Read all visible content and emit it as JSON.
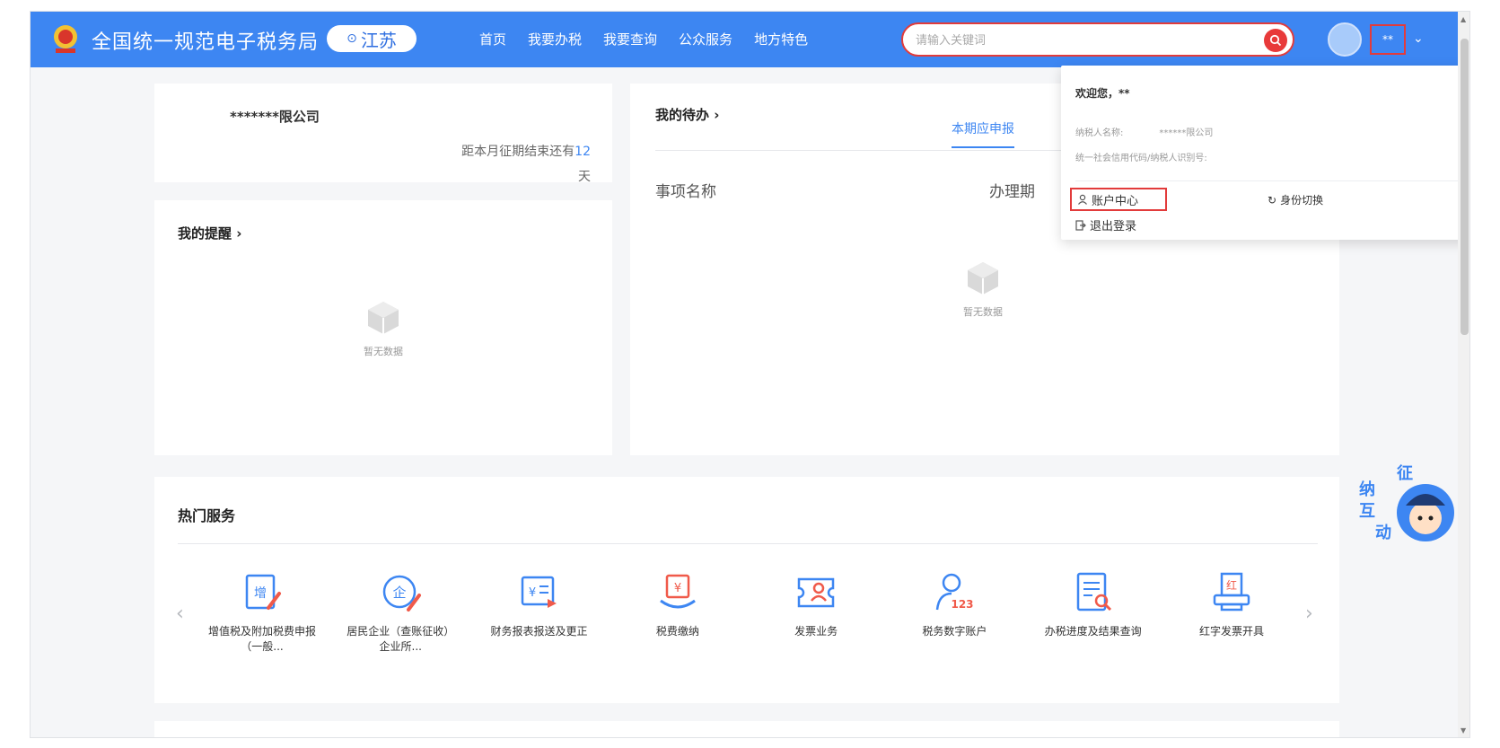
{
  "header": {
    "site_title": "全国统一规范电子税务局",
    "region": "江苏",
    "nav": [
      "首页",
      "我要办税",
      "我要查询",
      "公众服务",
      "地方特色"
    ],
    "search_placeholder": "请输入关键词",
    "user_short": "**"
  },
  "company": {
    "name": "*******限公司",
    "deadline_prefix": "距本月征期结束还有",
    "deadline_days": "12",
    "deadline_unit": "天"
  },
  "reminders": {
    "title": "我的提醒 ›",
    "empty_text": "暂无数据"
  },
  "todo": {
    "title": "我的待办 ›",
    "tab": "本期应申报",
    "col_name": "事项名称",
    "col_deadline": "办理期",
    "empty_text": "暂无数据"
  },
  "hot": {
    "title": "热门服务",
    "items": [
      {
        "label": "增值税及附加税费申报（一般...",
        "icon": "vat-declare-icon",
        "glyph": "增"
      },
      {
        "label": "居民企业（查账征收）企业所...",
        "icon": "enterprise-tax-icon",
        "glyph": "企"
      },
      {
        "label": "财务报表报送及更正",
        "icon": "financial-report-icon",
        "glyph": "¥"
      },
      {
        "label": "税费缴纳",
        "icon": "tax-payment-icon",
        "glyph": "¥"
      },
      {
        "label": "发票业务",
        "icon": "invoice-icon",
        "glyph": ""
      },
      {
        "label": "税务数字账户",
        "icon": "digital-account-icon",
        "glyph": "123"
      },
      {
        "label": "办税进度及结果查询",
        "icon": "progress-query-icon",
        "glyph": ""
      },
      {
        "label": "红字发票开具",
        "icon": "red-invoice-icon",
        "glyph": "红"
      }
    ]
  },
  "dropdown": {
    "welcome": "欢迎您，**",
    "taxpayer_label": "纳税人名称:",
    "taxpayer_value": "******限公司",
    "credit_label": "统一社会信用代码/纳税人识别号:",
    "account_center": "账户中心",
    "switch_identity": "身份切换",
    "logout": "退出登录"
  },
  "assistant": {
    "chars": [
      "征",
      "纳",
      "互",
      "动"
    ]
  },
  "colors": {
    "brand": "#3d86f2",
    "highlight": "#e23b3b"
  }
}
